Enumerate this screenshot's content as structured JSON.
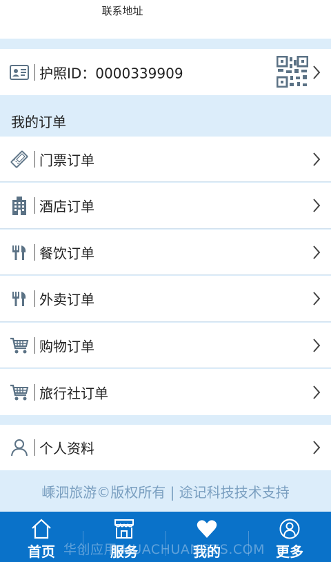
{
  "header": {
    "contact_link": "联系地址"
  },
  "passport": {
    "label": "护照ID：0000339909"
  },
  "orders": {
    "section_title": "我的订单",
    "items": [
      {
        "label": "门票订单",
        "icon": "ticket-icon"
      },
      {
        "label": "酒店订单",
        "icon": "hotel-icon"
      },
      {
        "label": "餐饮订单",
        "icon": "fork-knife-icon"
      },
      {
        "label": "外卖订单",
        "icon": "fork-knife-icon"
      },
      {
        "label": "购物订单",
        "icon": "cart-icon"
      },
      {
        "label": "旅行社订单",
        "icon": "cart-icon"
      }
    ]
  },
  "profile": {
    "label": "个人资料"
  },
  "footer": {
    "copyright": "嵊泗旅游©版权所有 | 途记科技技术支持"
  },
  "tabbar": {
    "items": [
      {
        "label": "首页",
        "icon": "home-icon"
      },
      {
        "label": "服务",
        "icon": "store-icon"
      },
      {
        "label": "我的",
        "icon": "heart-icon"
      },
      {
        "label": "更多",
        "icon": "user-circle-icon"
      }
    ]
  },
  "watermark": "华创应用 HUACHUANGZS.COM",
  "colors": {
    "accent": "#0a72c9",
    "background": "#dcedfa",
    "icon": "#5b7285"
  }
}
